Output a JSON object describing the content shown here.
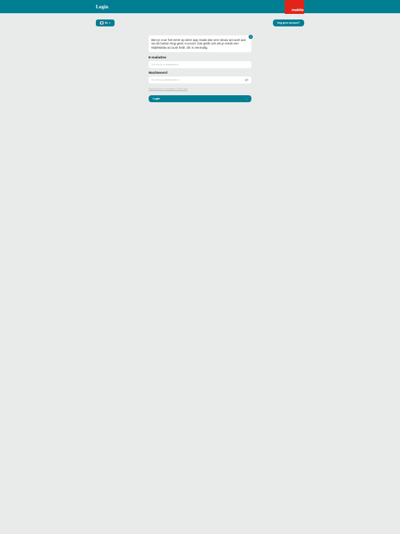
{
  "header": {
    "title": "Login",
    "brand": "makita",
    "bar_color": "#007f93",
    "brand_color": "#e2231a"
  },
  "language_button": {
    "label": "NL",
    "icon": "netherlands-flag-icon",
    "chevron_icon": "chevron-down-icon"
  },
  "register_button": {
    "label": "Nog geen account?"
  },
  "info_card": {
    "text": "Ben je voor het eerst op deze app maak dan een nieuw account aan via de button Nog geen Account. Dat geldt ook als je reeds een MijnMakita account hebt. Dit is eenmalig.",
    "badge": "i"
  },
  "email": {
    "label": "E-mailadres",
    "placeholder": "Vul hier je e-mailadres in",
    "value": ""
  },
  "password": {
    "label": "Wachtwoord",
    "placeholder": "Vul hier je wachtwoord in",
    "value": "",
    "toggle_icon": "eye-icon"
  },
  "forgot_link": {
    "label": "Wachtwoord vergeten? Klik hier"
  },
  "login_button": {
    "label": "Login",
    "arrow": "→"
  }
}
